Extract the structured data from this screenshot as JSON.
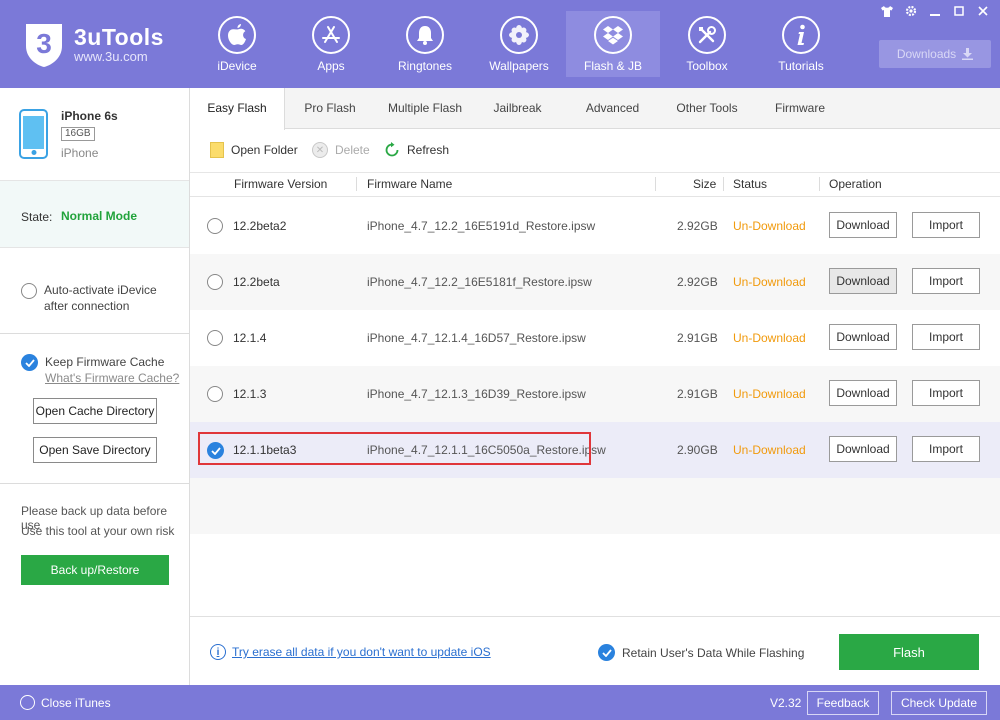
{
  "app": {
    "brand_name": "3uTools",
    "brand_url": "www.3u.com",
    "logo_glyph": "3"
  },
  "nav": [
    {
      "label": "iDevice",
      "icon": "apple-icon"
    },
    {
      "label": "Apps",
      "icon": "app-store-icon"
    },
    {
      "label": "Ringtones",
      "icon": "bell-icon"
    },
    {
      "label": "Wallpapers",
      "icon": "flower-icon"
    },
    {
      "label": "Flash & JB",
      "icon": "dropbox-icon"
    },
    {
      "label": "Toolbox",
      "icon": "tools-icon"
    },
    {
      "label": "Tutorials",
      "icon": "info-icon"
    }
  ],
  "header": {
    "downloads_label": "Downloads"
  },
  "device": {
    "name": "iPhone 6s",
    "capacity": "16GB",
    "type": "iPhone"
  },
  "sidebar": {
    "state_label": "State:",
    "state_value": "Normal Mode",
    "auto_activate_line1": "Auto-activate iDevice",
    "auto_activate_line2": "after connection",
    "keep_cache_label": "Keep Firmware Cache",
    "whats_cache_link": "What's Firmware Cache?",
    "open_cache_dir": "Open Cache Directory",
    "open_save_dir": "Open Save Directory",
    "warning_line1": "Please back up data before use",
    "warning_line2": "Use this tool at your own risk",
    "backup_button": "Back up/Restore"
  },
  "tabs": [
    "Easy Flash",
    "Pro Flash",
    "Multiple Flash",
    "Jailbreak",
    "Advanced",
    "Other Tools",
    "Firmware"
  ],
  "toolbar": {
    "open_folder": "Open Folder",
    "delete": "Delete",
    "refresh": "Refresh"
  },
  "table": {
    "headers": {
      "version": "Firmware Version",
      "name": "Firmware Name",
      "size": "Size",
      "status": "Status",
      "operation": "Operation"
    },
    "rows": [
      {
        "version": "12.2beta2",
        "name": "iPhone_4.7_12.2_16E5191d_Restore.ipsw",
        "size": "2.92GB",
        "status": "Un-Download",
        "download": "Download",
        "import": "Import",
        "selected": false
      },
      {
        "version": "12.2beta",
        "name": "iPhone_4.7_12.2_16E5181f_Restore.ipsw",
        "size": "2.92GB",
        "status": "Un-Download",
        "download": "Download",
        "import": "Import",
        "selected": false
      },
      {
        "version": "12.1.4",
        "name": "iPhone_4.7_12.1.4_16D57_Restore.ipsw",
        "size": "2.91GB",
        "status": "Un-Download",
        "download": "Download",
        "import": "Import",
        "selected": false
      },
      {
        "version": "12.1.3",
        "name": "iPhone_4.7_12.1.3_16D39_Restore.ipsw",
        "size": "2.91GB",
        "status": "Un-Download",
        "download": "Download",
        "import": "Import",
        "selected": false
      },
      {
        "version": "12.1.1beta3",
        "name": "iPhone_4.7_12.1.1_16C5050a_Restore.ipsw",
        "size": "2.90GB",
        "status": "Un-Download",
        "download": "Download",
        "import": "Import",
        "selected": true
      }
    ]
  },
  "bottom": {
    "erase_link": "Try erase all data if you don't want to update iOS",
    "retain_label": "Retain User's Data While Flashing",
    "flash_button": "Flash"
  },
  "footer": {
    "close_itunes": "Close iTunes",
    "version": "V2.32",
    "feedback": "Feedback",
    "check_update": "Check Update"
  },
  "colors": {
    "header_bg": "#7b79d8",
    "accent_green": "#2aa845",
    "status_orange": "#f19a0c",
    "check_blue": "#2a82de",
    "highlight_red": "#e0363a"
  }
}
